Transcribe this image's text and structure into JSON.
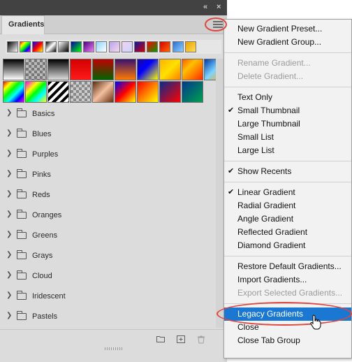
{
  "panel": {
    "title": "Gradients",
    "controls": {
      "collapse": "«",
      "close": "×"
    }
  },
  "recents": [
    "linear-gradient(135deg,#000 0%,#fff 100%)",
    "linear-gradient(135deg,#f00 0%,#ff0 25%,#0f0 50%,#00f 75%,#f0f 100%)",
    "linear-gradient(135deg,#00f 0%,#f00 50%,#ff0 100%)",
    "linear-gradient(135deg,#000 0%,#fff 50%,#000 100%)",
    "linear-gradient(135deg,#fff 0%,#000 100%)",
    "linear-gradient(135deg,#00a 0%,#0f0 100%)",
    "linear-gradient(135deg,#4b0082 0%,#ee82ee 100%)",
    "linear-gradient(135deg,#8fd3ff 0%,#fff 100%)",
    "linear-gradient(135deg,#b9a5e6 0%,#f7d6ef 100%)",
    "linear-gradient(135deg,#f5d0f0 0%,#c6d7ff 100%)",
    "linear-gradient(135deg,#0a1aa8 0%,#d80000 100%)",
    "linear-gradient(135deg,#ff0000 0%,#00a000 100%)",
    "linear-gradient(135deg,#d60000 0%,#ff6a00 100%)",
    "linear-gradient(135deg,#2c6fd1 0%,#8fd0ff 100%)",
    "linear-gradient(135deg,#e8a000 0%,#ffde59 100%)"
  ],
  "gradients": [
    "linear-gradient(180deg,#000 0%,#fff 100%)",
    "repeating-conic-gradient(#777 0% 25%,#bbb 0% 50%) 0 0/8px 8px",
    "linear-gradient(180deg,#000 0%,#ddd 100%)",
    "linear-gradient(180deg,#d40000 0%,#ff1a1a 100%)",
    "linear-gradient(180deg,#c00000 0%,#006400 100%)",
    "linear-gradient(180deg,#3a1070 0%,#ff7b00 100%)",
    "linear-gradient(135deg,#1a0a9c 0%,#0000ff 40%,#ffff00 100%)",
    "linear-gradient(135deg,#ffb300 0%,#ffe000 50%,#ff8000 100%)",
    "linear-gradient(135deg,#ff5a00 0%,#ffc000 35%,#ff2a00 100%)",
    "linear-gradient(135deg,#003aa8 0%,#7dd3ff 50%,#ffb000 100%)",
    "linear-gradient(135deg,#ff0000 0%,#ff0 20%,#0f0 40%,#0ff 60%,#00f 80%,#f0f 100%)",
    "linear-gradient(135deg,#ff00ff 0%,#ff0 30%,#0f0 50%,#0ff 70%,#ff0 100%)",
    "repeating-linear-gradient(135deg,#000 0 4px,#fff 4px 8px)",
    "repeating-conic-gradient(#888 0% 25%,#ccc 0% 50%) 0 0/8px 8px",
    "linear-gradient(135deg,#5a2c10 0%,#f3c0a0 50%,#6a2d10 100%)",
    "linear-gradient(135deg,#0000ff 0%,#ff0000 50%,#ffff00 100%)",
    "linear-gradient(135deg,#ff0000 0%,#ffff00 100%)",
    "linear-gradient(135deg,#0a2a8c 0%,#ff0000 100%)",
    "linear-gradient(135deg,#003a8c 0%,#00a050 100%)"
  ],
  "folders": [
    "Basics",
    "Blues",
    "Purples",
    "Pinks",
    "Reds",
    "Oranges",
    "Greens",
    "Grays",
    "Cloud",
    "Iridescent",
    "Pastels"
  ],
  "menu": {
    "items": [
      {
        "label": "New Gradient Preset...",
        "disabled": false,
        "checked": false
      },
      {
        "label": "New Gradient Group...",
        "disabled": false,
        "checked": false
      },
      {
        "label": "Rename Gradient...",
        "disabled": true,
        "checked": false
      },
      {
        "label": "Delete Gradient...",
        "disabled": true,
        "checked": false
      },
      {
        "label": "Text Only",
        "disabled": false,
        "checked": false
      },
      {
        "label": "Small Thumbnail",
        "disabled": false,
        "checked": true
      },
      {
        "label": "Large Thumbnail",
        "disabled": false,
        "checked": false
      },
      {
        "label": "Small List",
        "disabled": false,
        "checked": false
      },
      {
        "label": "Large List",
        "disabled": false,
        "checked": false
      },
      {
        "label": "Show Recents",
        "disabled": false,
        "checked": true
      },
      {
        "label": "Linear Gradient",
        "disabled": false,
        "checked": true
      },
      {
        "label": "Radial Gradient",
        "disabled": false,
        "checked": false
      },
      {
        "label": "Angle Gradient",
        "disabled": false,
        "checked": false
      },
      {
        "label": "Reflected Gradient",
        "disabled": false,
        "checked": false
      },
      {
        "label": "Diamond Gradient",
        "disabled": false,
        "checked": false
      },
      {
        "label": "Restore Default Gradients...",
        "disabled": false,
        "checked": false
      },
      {
        "label": "Import Gradients...",
        "disabled": false,
        "checked": false
      },
      {
        "label": "Export Selected Gradients...",
        "disabled": true,
        "checked": false
      },
      {
        "label": "Legacy Gradients",
        "disabled": false,
        "checked": false,
        "highlighted": true
      },
      {
        "label": "Close",
        "disabled": false,
        "checked": false
      },
      {
        "label": "Close Tab Group",
        "disabled": false,
        "checked": false
      }
    ],
    "check_glyph": "✔"
  },
  "colors": {
    "highlight": "#1a77d2",
    "annotation_ring": "#e0463f"
  }
}
